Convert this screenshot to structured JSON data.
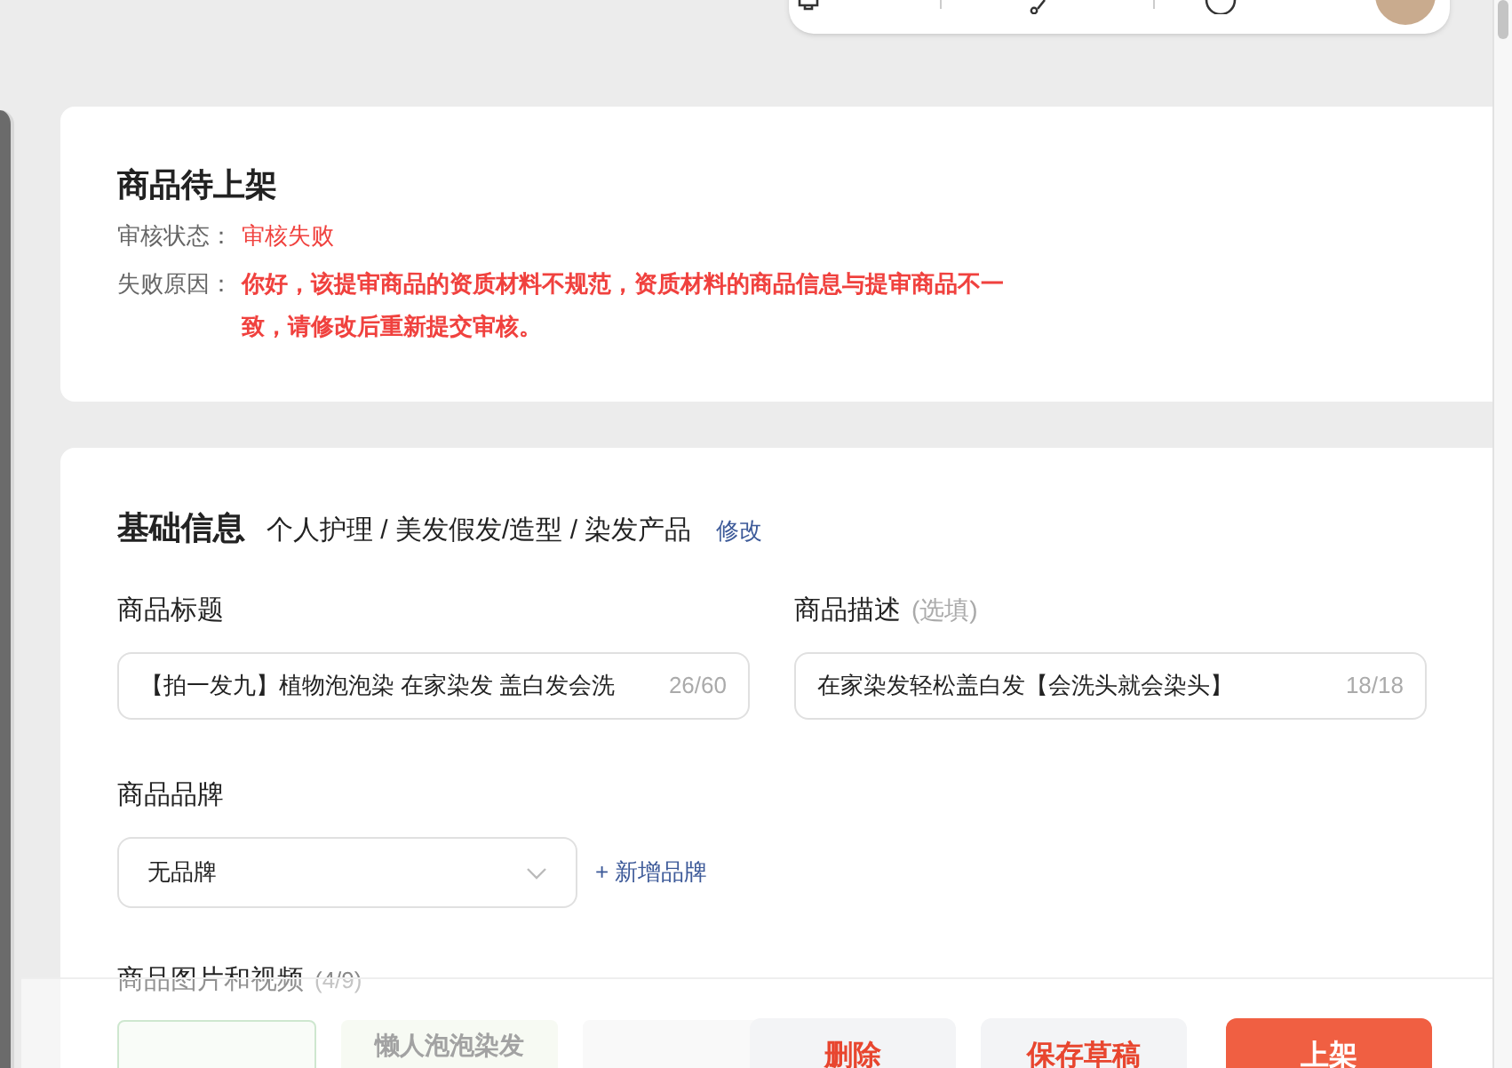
{
  "status_card": {
    "title": "商品待上架",
    "status_label": "审核状态：",
    "status_value": "审核失败",
    "reason_label": "失败原因：",
    "reason_text": "你好，该提审商品的资质材料不规范，资质材料的商品信息与提审商品不一致，请修改后重新提交审核。"
  },
  "basic_info": {
    "heading": "基础信息",
    "category_path": "个人护理 / 美发假发/造型 / 染发产品",
    "edit_link": "修改",
    "title_field": {
      "label": "商品标题",
      "value": "【拍一发九】植物泡泡染 在家染发 盖白发会洗",
      "counter": "26/60"
    },
    "description_field": {
      "label": "商品描述",
      "optional": "(选填)",
      "value": "在家染发轻松盖白发【会洗头就会染头】",
      "counter": "18/18"
    },
    "brand_field": {
      "label": "商品品牌",
      "value": "无品牌",
      "add_link": "+ 新增品牌"
    },
    "media_section": {
      "label": "商品图片和视频",
      "count": "(4/9)",
      "thumbnail_text": "懒人泡泡染发"
    }
  },
  "action_bar": {
    "buttons": [
      {
        "label": "删除",
        "kind": "secondary"
      },
      {
        "label": "保存草稿",
        "kind": "secondary"
      },
      {
        "label": "上架",
        "kind": "primary"
      }
    ]
  }
}
